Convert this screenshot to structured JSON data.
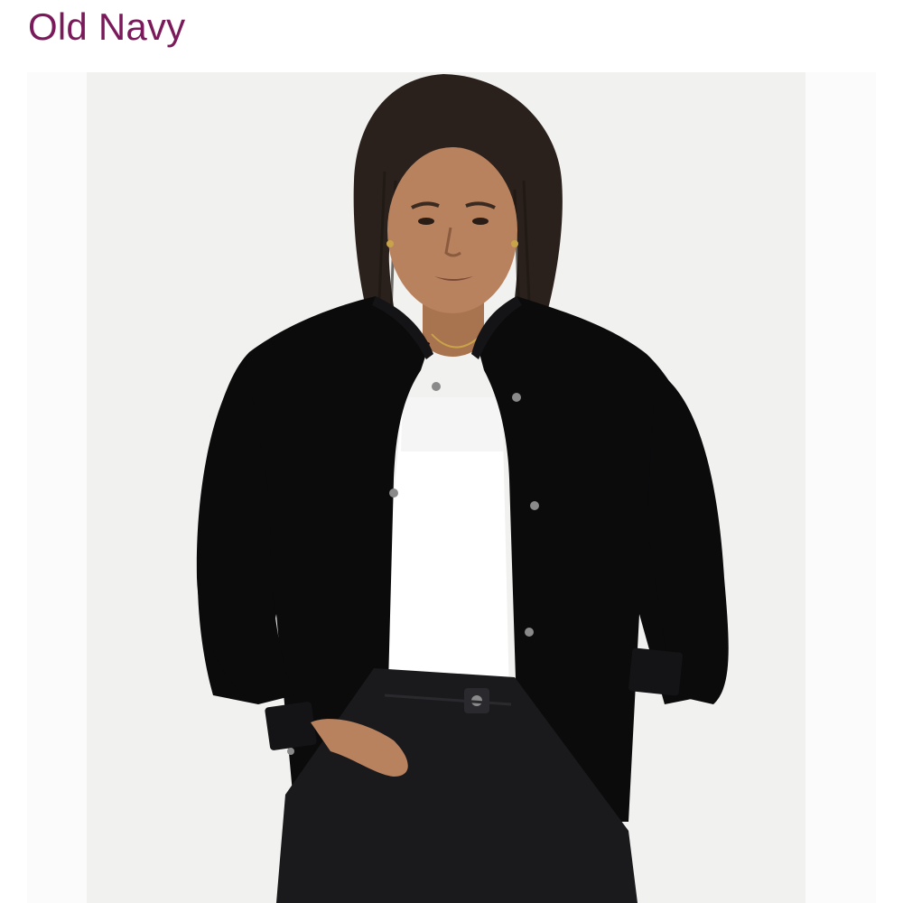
{
  "header": {
    "brand": "Old Navy"
  },
  "product": {
    "image_icon": "product-photo",
    "colors": {
      "brand": "#7a1a5a",
      "jacket": "#0b0b0c",
      "tank": "#ffffff",
      "jeans": "#1a1a1d",
      "backdrop": "#eeeeec",
      "skin": "#b9825f"
    }
  }
}
